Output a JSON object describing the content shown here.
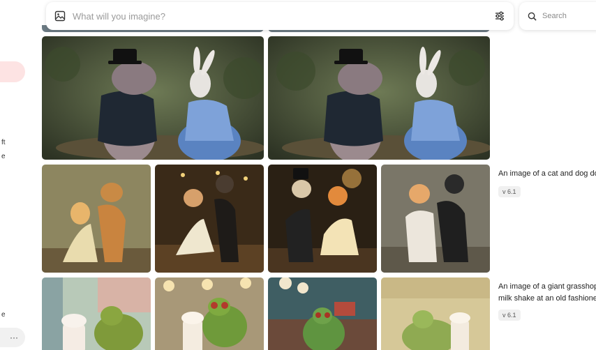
{
  "prompt": {
    "placeholder": "What will you imagine?"
  },
  "search": {
    "placeholder": "Search"
  },
  "sidebar": {
    "fragments": [
      "ft",
      "e",
      "e"
    ],
    "more_label": "···"
  },
  "groups": [
    {
      "caption": "An image of a cat and dog do",
      "version": "v 6.1"
    },
    {
      "caption_line1": "An image of a giant grasshop",
      "caption_line2": "milk shake at an old fashione",
      "version": "v 6.1"
    }
  ],
  "icons": {
    "prompt": "image-icon",
    "settings": "sliders-icon",
    "search": "search-icon"
  },
  "colors": {
    "accent_pill": "#fde3e3",
    "badge_bg": "#f0f0f0"
  }
}
